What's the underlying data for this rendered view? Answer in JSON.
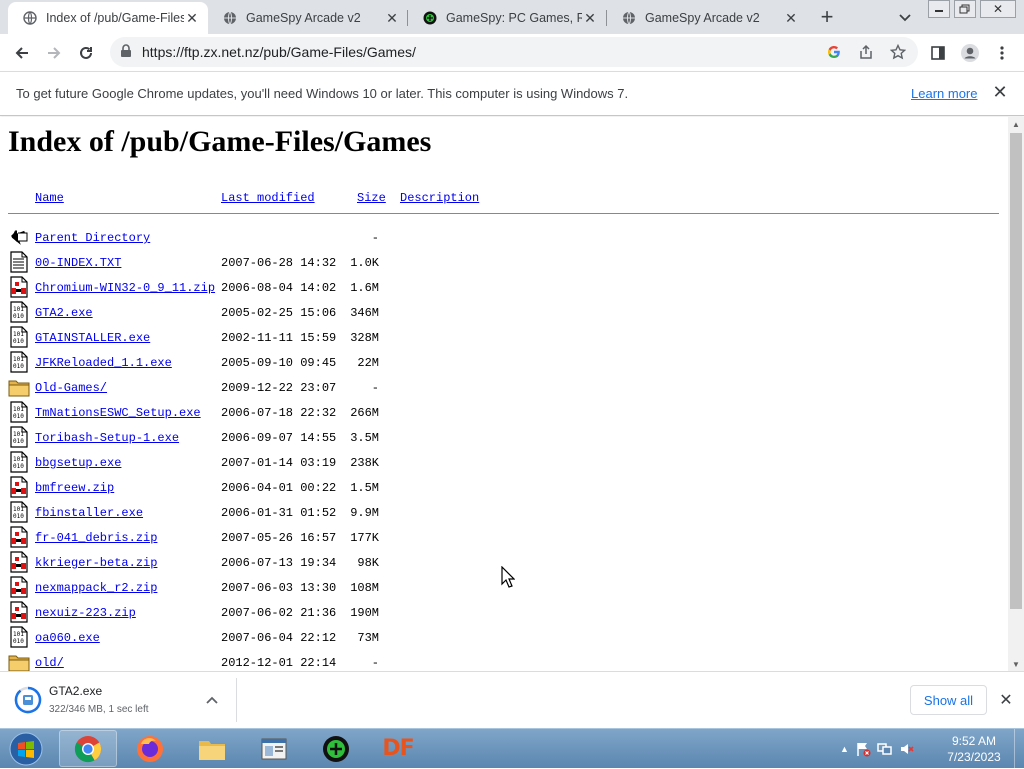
{
  "tabs": [
    {
      "title": "Index of /pub/Game-Files",
      "icon": "globe-icon",
      "active": true
    },
    {
      "title": "GameSpy Arcade v2",
      "icon": "globe-icon",
      "active": false
    },
    {
      "title": "GameSpy: PC Games, Rev",
      "icon": "gamespy-icon",
      "active": false
    },
    {
      "title": "GameSpy Arcade v2",
      "icon": "globe-icon",
      "active": false
    }
  ],
  "toolbar": {
    "url": "https://ftp.zx.net.nz/pub/Game-Files/Games/"
  },
  "infobar": {
    "message": "To get future Google Chrome updates, you'll need Windows 10 or later. This computer is using Windows 7.",
    "learn_more": "Learn more"
  },
  "page": {
    "title": "Index of /pub/Game-Files/Games",
    "columns": {
      "name": "Name",
      "modified": "Last modified",
      "size": "Size",
      "description": "Description"
    },
    "rows": [
      {
        "name": "Parent Directory",
        "modified": "",
        "size": "-",
        "icon": "back-icon"
      },
      {
        "name": "00-INDEX.TXT",
        "modified": "2007-06-28 14:32",
        "size": "1.0K",
        "icon": "text-file-icon"
      },
      {
        "name": "Chromium-WIN32-0_9_11.zip",
        "modified": "2006-08-04 14:02",
        "size": "1.6M",
        "icon": "compressed-file-icon"
      },
      {
        "name": "GTA2.exe",
        "modified": "2005-02-25 15:06",
        "size": "346M",
        "icon": "binary-file-icon"
      },
      {
        "name": "GTAINSTALLER.exe",
        "modified": "2002-11-11 15:59",
        "size": "328M",
        "icon": "binary-file-icon"
      },
      {
        "name": "JFKReloaded_1.1.exe",
        "modified": "2005-09-10 09:45",
        "size": " 22M",
        "icon": "binary-file-icon"
      },
      {
        "name": "Old-Games/",
        "modified": "2009-12-22 23:07",
        "size": "  -",
        "icon": "folder-icon"
      },
      {
        "name": "TmNationsESWC_Setup.exe",
        "modified": "2006-07-18 22:32",
        "size": "266M",
        "icon": "binary-file-icon"
      },
      {
        "name": "Toribash-Setup-1.exe",
        "modified": "2006-09-07 14:55",
        "size": "3.5M",
        "icon": "binary-file-icon"
      },
      {
        "name": "bbgsetup.exe",
        "modified": "2007-01-14 03:19",
        "size": "238K",
        "icon": "binary-file-icon"
      },
      {
        "name": "bmfreew.zip",
        "modified": "2006-04-01 00:22",
        "size": "1.5M",
        "icon": "compressed-file-icon"
      },
      {
        "name": "fbinstaller.exe",
        "modified": "2006-01-31 01:52",
        "size": "9.9M",
        "icon": "binary-file-icon"
      },
      {
        "name": "fr-041_debris.zip",
        "modified": "2007-05-26 16:57",
        "size": "177K",
        "icon": "compressed-file-icon"
      },
      {
        "name": "kkrieger-beta.zip",
        "modified": "2006-07-13 19:34",
        "size": " 98K",
        "icon": "compressed-file-icon"
      },
      {
        "name": "nexmappack_r2.zip",
        "modified": "2007-06-03 13:30",
        "size": "108M",
        "icon": "compressed-file-icon"
      },
      {
        "name": "nexuiz-223.zip",
        "modified": "2007-06-02 21:36",
        "size": "190M",
        "icon": "compressed-file-icon"
      },
      {
        "name": "oa060.exe",
        "modified": "2007-06-04 22:12",
        "size": " 73M",
        "icon": "binary-file-icon"
      },
      {
        "name": "old/",
        "modified": "2012-12-01 22:14",
        "size": "  -",
        "icon": "folder-icon"
      }
    ]
  },
  "download": {
    "filename": "GTA2.exe",
    "status": "322/346 MB, 1 sec left",
    "show_all": "Show all"
  },
  "taskbar": {
    "items": [
      "chrome-icon",
      "firefox-icon",
      "explorer-icon",
      "window-icon",
      "gamespy-icon",
      "df-icon"
    ],
    "df_label": "DF",
    "time": "9:52 AM",
    "date": "7/23/2023"
  },
  "colors": {
    "link": "#0000ee",
    "chrome_blue": "#1a73e8",
    "tabstrip": "#dee1e6"
  }
}
